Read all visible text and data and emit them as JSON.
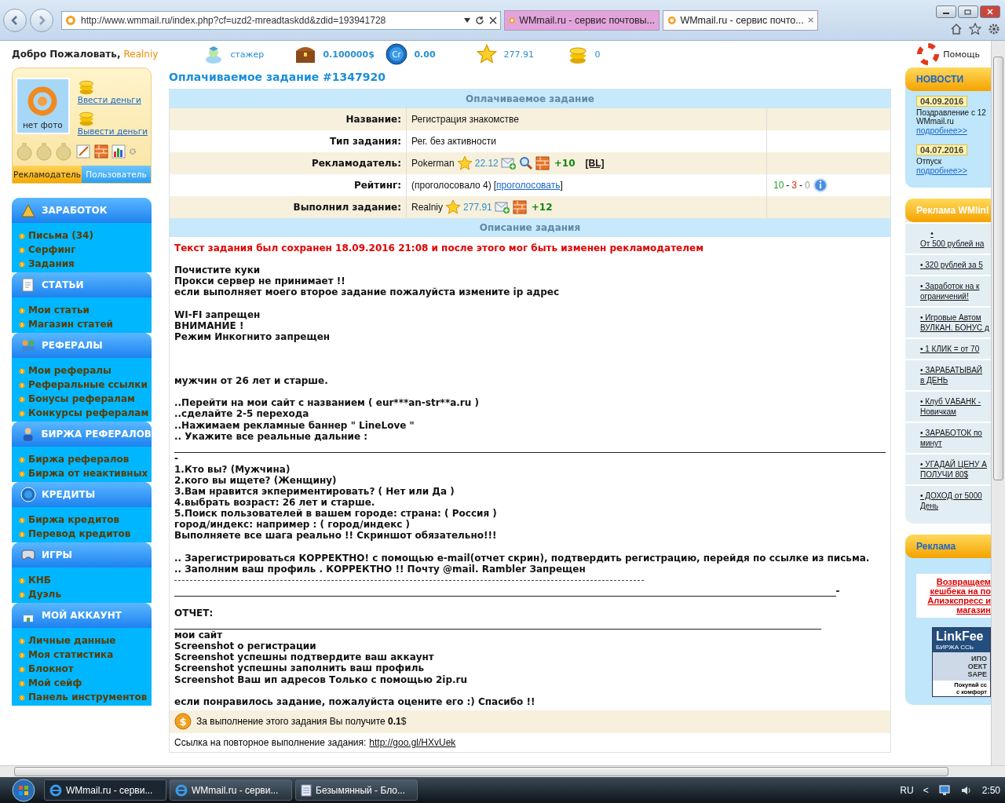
{
  "browser": {
    "address": "http://www.wmmail.ru/index.php?cf=uzd2-mreadtaskdd&zdid=193941728",
    "tabs": [
      {
        "title": "WMmail.ru - сервис почтовы...",
        "selected": false
      },
      {
        "title": "WMmail.ru - сервис почто...",
        "selected": true
      }
    ]
  },
  "topbar": {
    "welcome": "Добро Пожаловать,",
    "username": "Realniy",
    "stats": [
      {
        "kind": "status",
        "text": "стажер"
      },
      {
        "kind": "chest",
        "text": "0.100000$"
      },
      {
        "kind": "credit",
        "text": "0.00",
        "badge": "Cr"
      },
      {
        "kind": "star",
        "text": "277.91"
      },
      {
        "kind": "coins",
        "text": "0"
      }
    ],
    "help": "Помощь"
  },
  "profile": {
    "photo": "нет фото",
    "links": [
      "Ввести деньги",
      "Вывести деньги"
    ],
    "roles": [
      {
        "label": "Рекламодатель",
        "selected": true
      },
      {
        "label": "Пользователь",
        "selected": false
      }
    ]
  },
  "menu": [
    {
      "title": "ЗАРАБОТОК",
      "kind": "pyramid",
      "items": [
        "Письма (34)",
        "Серфинг",
        "Задания"
      ]
    },
    {
      "title": "СТАТЬИ",
      "kind": "note",
      "items": [
        "Мои статьи",
        "Магазин статей"
      ]
    },
    {
      "title": "РЕФЕРАЛЫ",
      "kind": "people",
      "items": [
        "Мои рефералы",
        "Реферальные ссылки",
        "Бонусы рефералам",
        "Конкурсы рефералам"
      ]
    },
    {
      "title": "БИРЖА РЕФЕРАЛОВ",
      "kind": "person",
      "items": [
        "Биржа рефералов",
        "Биржа от неактивных"
      ]
    },
    {
      "title": "КРЕДИТЫ",
      "kind": "credit",
      "items": [
        "Биржа кредитов",
        "Перевод кредитов"
      ]
    },
    {
      "title": "ИГРЫ",
      "kind": "gamepad",
      "items": [
        "КНБ",
        "Дуэль"
      ]
    },
    {
      "title": "МОЙ АККАУНТ",
      "kind": "house",
      "items": [
        "Личные данные",
        "Моя статистика",
        "Блокнот",
        "Мой сейф",
        "Панель инструментов"
      ]
    }
  ],
  "task": {
    "title": "Оплачиваемое задание #1347920",
    "heading": "Оплачиваемое задание",
    "rows": [
      {
        "kind": "text",
        "label": "Название:",
        "value": "Регистрация знакомстве"
      },
      {
        "kind": "text",
        "label": "Тип задания:",
        "value": "Рег. без активности"
      },
      {
        "kind": "user",
        "label": "Рекламодатель:",
        "name": "Pokerman",
        "rating": "22.12",
        "plus": "+10",
        "bl": "[BL]"
      },
      {
        "kind": "rating",
        "label": "Рейтинг:",
        "value": "(проголосовало 4)",
        "open": "[",
        "link": "проголосовать",
        "close": "]",
        "separator": "-",
        "counts": [
          {
            "text": "10",
            "color": "#339933"
          },
          {
            "text": "3",
            "color": "#cc3300"
          },
          {
            "text": "0",
            "color": "#999999"
          }
        ]
      },
      {
        "kind": "user",
        "label": "Выполнил задание:",
        "name": "Realniy",
        "rating": "277.91",
        "plus": "+12"
      }
    ],
    "description_heading": "Описание задания",
    "lines": [
      {
        "kind": "notice",
        "text": "Текст задания был сохранен 18.09.2016 21:08 и после этого мог быть изменен рекламодателем"
      },
      {
        "kind": "blank"
      },
      {
        "kind": "text",
        "text": "Почистите куки"
      },
      {
        "kind": "text",
        "text": "Прокси сервер не принимает !!"
      },
      {
        "kind": "text",
        "text": "если выполняет моего второе задание пожалуйста измените ip адрес"
      },
      {
        "kind": "blank"
      },
      {
        "kind": "text",
        "text": "WI-FI запрещен"
      },
      {
        "kind": "text",
        "text": "ВНИМАНИЕ !"
      },
      {
        "kind": "text",
        "text": "Режим Инкогнито запрещен"
      },
      {
        "kind": "blank"
      },
      {
        "kind": "blank"
      },
      {
        "kind": "blank"
      },
      {
        "kind": "text",
        "text": "мужчин от 26 лет и старше."
      },
      {
        "kind": "blank"
      },
      {
        "kind": "text",
        "text": "..Перейти на мои сайт с названием ( eur***an-str**a.ru )"
      },
      {
        "kind": "text",
        "text": "..сделайте 2-5 перехода"
      },
      {
        "kind": "text",
        "text": "..Нажимаем рекламные баннер \" LineLove \""
      },
      {
        "kind": "text",
        "text": ".. Укажите все реальные дальние :"
      },
      {
        "kind": "rule"
      },
      {
        "kind": "text",
        "text": "-"
      },
      {
        "kind": "text",
        "text": "1.Кто вы? (Мужчина)"
      },
      {
        "kind": "text",
        "text": "2.кого вы ищете? (Женщину)"
      },
      {
        "kind": "text",
        "text": "3.Вам нравится экпериментировать? ( Нет или Да )"
      },
      {
        "kind": "text",
        "text": "4.выбрать возраст: 26 лет и старше."
      },
      {
        "kind": "text",
        "text": "5.Поиск пользователей в вашем городе: страна: ( Россия )"
      },
      {
        "kind": "text",
        "text": "город/индекс: например : ( город/индекс )"
      },
      {
        "kind": "text",
        "text": "Выполняете все шага реально !! Скриншот обязательно!!!"
      },
      {
        "kind": "blank"
      },
      {
        "kind": "text",
        "text": ".. Зарегистрироваться КОРРЕКТНО! с помощью e-mail(отчет скрин), подтвердить регистрацию, перейдя по ссылке из письма."
      },
      {
        "kind": "text",
        "text": ".. Заполним ваш профиль . КОРРЕКТНО !! Почту @mail. Rambler Запрещен"
      },
      {
        "kind": "dashes"
      },
      {
        "kind": "rule",
        "tail": "-"
      },
      {
        "kind": "blank"
      },
      {
        "kind": "text",
        "text": "ОТЧЕТ:"
      },
      {
        "kind": "short_rule"
      },
      {
        "kind": "text",
        "text": "мои сайт"
      },
      {
        "kind": "text",
        "text": "Screenshot о регистрации"
      },
      {
        "kind": "text",
        "text": "Screenshot успешны подтвердите ваш аккаунт"
      },
      {
        "kind": "text",
        "text": "Screenshot успешны заполнить ваш профиль"
      },
      {
        "kind": "text",
        "text": "Screenshot Ваш ип адресов Только с помощью 2ip.ru"
      },
      {
        "kind": "blank"
      },
      {
        "kind": "text",
        "text": "если понравилось задание, пожалуйста оцените его :) Спасибо !!"
      }
    ],
    "coin_symbol": "$",
    "reward": "За выполнение этого задания Вы получите **0.1**$",
    "repeat_label": "Ссылка на повторное выполнение задания:",
    "repeat_link": "http://goo.gl/HXvUek"
  },
  "news": {
    "title": "НОВОСТИ",
    "items": [
      {
        "date": "04.09.2016",
        "lines": [
          "Поздравление с 12",
          "WMmail.ru"
        ],
        "link": "подробнее>>"
      },
      {
        "date": "04.07.2016",
        "lines": [
          "Отпуск"
        ],
        "link": "подробнее>>"
      }
    ]
  },
  "ads": {
    "title": "Реклама WMlinl",
    "items": [
      [
        "•",
        "От 500 рублей на"
      ],
      [
        "• 320 рублей за 5"
      ],
      [
        "• Заработок на к",
        "ограничений!"
      ],
      [
        "• Игровые Автом",
        "ВУЛКАН. БОНУС д"
      ],
      [
        "• 1 КЛИК = от 70"
      ],
      [
        "• ЗАРАБАТЫВАЙ",
        "в ДЕНЬ"
      ],
      [
        "• Клуб VАБАНК -",
        "Новичкам"
      ],
      [
        "• ЗАРАБОТОК по",
        "минут"
      ],
      [
        "• УГАДАЙ ЦЕНУ А",
        "ПОЛУЧИ 80$"
      ],
      [
        "• ДОХОД от 5000",
        "День"
      ]
    ]
  },
  "promo": {
    "title": "Реклама",
    "banner": [
      "Возвращаем",
      "кешбека на по",
      "Алиэкспресс и",
      "магазин"
    ],
    "linkfeed": {
      "brand": "LinkFee",
      "tagline": "БИРЖА ССЬ",
      "middle": [
        "ИПО",
        "ОЕКТ",
        "SAPE"
      ],
      "footer": [
        "Покупай сс",
        "с комфорт"
      ]
    }
  },
  "taskbar": {
    "windows": [
      {
        "title": "WMmail.ru - серви...",
        "kind": "browser",
        "selected": true
      },
      {
        "title": "WMmail.ru - серви...",
        "kind": "browser",
        "selected": false
      },
      {
        "title": "Безымянный - Бло...",
        "kind": "notepad",
        "selected": false
      }
    ],
    "language": "RU",
    "chevron": "<",
    "time": "2:50"
  }
}
